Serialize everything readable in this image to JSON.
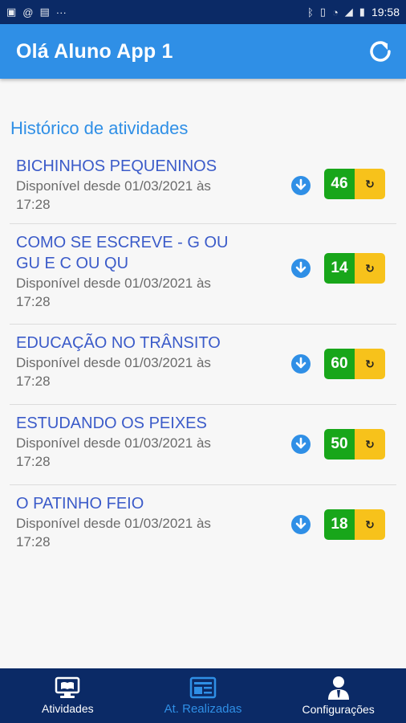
{
  "status_bar": {
    "left_icons": [
      "image-icon",
      "at-icon",
      "gallery-icon",
      "more-icon"
    ],
    "right_icons": [
      "bluetooth-icon",
      "vibrate-icon",
      "wifi-icon",
      "signal-icon",
      "battery-icon"
    ],
    "time": "19:58"
  },
  "app_bar": {
    "title": "Olá Aluno App 1"
  },
  "section_title": "Histórico de atividades",
  "activities": [
    {
      "title": "BICHINHOS PEQUENINOS",
      "subtitle": "Disponível desde 01/03/2021 às 17:28",
      "score": "46"
    },
    {
      "title": "COMO SE ESCREVE - G OU GU E C OU QU",
      "subtitle": "Disponível desde 01/03/2021 às 17:28",
      "score": "14"
    },
    {
      "title": "EDUCAÇÃO NO TRÂNSITO",
      "subtitle": "Disponível desde 01/03/2021 às 17:28",
      "score": "60"
    },
    {
      "title": "ESTUDANDO OS PEIXES",
      "subtitle": "Disponível desde 01/03/2021 às 17:28",
      "score": "50"
    },
    {
      "title": "O PATINHO FEIO",
      "subtitle": "Disponível desde 01/03/2021 às 17:28",
      "score": "18"
    }
  ],
  "bottom_nav": {
    "items": [
      {
        "label": "Atividades",
        "icon": "monitor-book-icon"
      },
      {
        "label": "At. Realizadas",
        "icon": "news-list-icon",
        "active": true
      },
      {
        "label": "Configurações",
        "icon": "user-tie-icon"
      }
    ]
  },
  "colors": {
    "primary": "#2f8fe6",
    "dark_navy": "#0b2a66",
    "item_title": "#3b5bc9",
    "score_green": "#18a61a",
    "score_yellow": "#f7c21b"
  }
}
